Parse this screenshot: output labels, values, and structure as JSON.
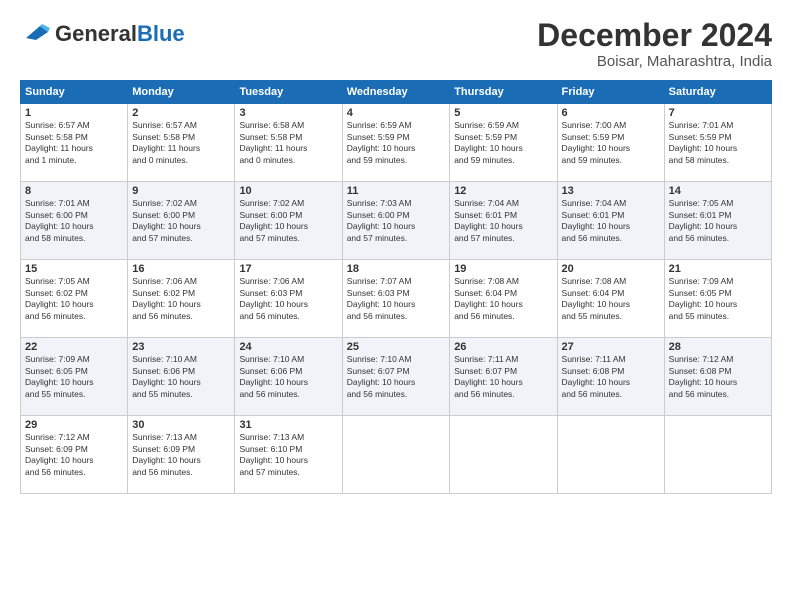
{
  "logo": {
    "general": "General",
    "blue": "Blue"
  },
  "title": "December 2024",
  "location": "Boisar, Maharashtra, India",
  "days_of_week": [
    "Sunday",
    "Monday",
    "Tuesday",
    "Wednesday",
    "Thursday",
    "Friday",
    "Saturday"
  ],
  "weeks": [
    [
      {
        "day": "1",
        "info": "Sunrise: 6:57 AM\nSunset: 5:58 PM\nDaylight: 11 hours\nand 1 minute."
      },
      {
        "day": "2",
        "info": "Sunrise: 6:57 AM\nSunset: 5:58 PM\nDaylight: 11 hours\nand 0 minutes."
      },
      {
        "day": "3",
        "info": "Sunrise: 6:58 AM\nSunset: 5:58 PM\nDaylight: 11 hours\nand 0 minutes."
      },
      {
        "day": "4",
        "info": "Sunrise: 6:59 AM\nSunset: 5:59 PM\nDaylight: 10 hours\nand 59 minutes."
      },
      {
        "day": "5",
        "info": "Sunrise: 6:59 AM\nSunset: 5:59 PM\nDaylight: 10 hours\nand 59 minutes."
      },
      {
        "day": "6",
        "info": "Sunrise: 7:00 AM\nSunset: 5:59 PM\nDaylight: 10 hours\nand 59 minutes."
      },
      {
        "day": "7",
        "info": "Sunrise: 7:01 AM\nSunset: 5:59 PM\nDaylight: 10 hours\nand 58 minutes."
      }
    ],
    [
      {
        "day": "8",
        "info": "Sunrise: 7:01 AM\nSunset: 6:00 PM\nDaylight: 10 hours\nand 58 minutes."
      },
      {
        "day": "9",
        "info": "Sunrise: 7:02 AM\nSunset: 6:00 PM\nDaylight: 10 hours\nand 57 minutes."
      },
      {
        "day": "10",
        "info": "Sunrise: 7:02 AM\nSunset: 6:00 PM\nDaylight: 10 hours\nand 57 minutes."
      },
      {
        "day": "11",
        "info": "Sunrise: 7:03 AM\nSunset: 6:00 PM\nDaylight: 10 hours\nand 57 minutes."
      },
      {
        "day": "12",
        "info": "Sunrise: 7:04 AM\nSunset: 6:01 PM\nDaylight: 10 hours\nand 57 minutes."
      },
      {
        "day": "13",
        "info": "Sunrise: 7:04 AM\nSunset: 6:01 PM\nDaylight: 10 hours\nand 56 minutes."
      },
      {
        "day": "14",
        "info": "Sunrise: 7:05 AM\nSunset: 6:01 PM\nDaylight: 10 hours\nand 56 minutes."
      }
    ],
    [
      {
        "day": "15",
        "info": "Sunrise: 7:05 AM\nSunset: 6:02 PM\nDaylight: 10 hours\nand 56 minutes."
      },
      {
        "day": "16",
        "info": "Sunrise: 7:06 AM\nSunset: 6:02 PM\nDaylight: 10 hours\nand 56 minutes."
      },
      {
        "day": "17",
        "info": "Sunrise: 7:06 AM\nSunset: 6:03 PM\nDaylight: 10 hours\nand 56 minutes."
      },
      {
        "day": "18",
        "info": "Sunrise: 7:07 AM\nSunset: 6:03 PM\nDaylight: 10 hours\nand 56 minutes."
      },
      {
        "day": "19",
        "info": "Sunrise: 7:08 AM\nSunset: 6:04 PM\nDaylight: 10 hours\nand 56 minutes."
      },
      {
        "day": "20",
        "info": "Sunrise: 7:08 AM\nSunset: 6:04 PM\nDaylight: 10 hours\nand 55 minutes."
      },
      {
        "day": "21",
        "info": "Sunrise: 7:09 AM\nSunset: 6:05 PM\nDaylight: 10 hours\nand 55 minutes."
      }
    ],
    [
      {
        "day": "22",
        "info": "Sunrise: 7:09 AM\nSunset: 6:05 PM\nDaylight: 10 hours\nand 55 minutes."
      },
      {
        "day": "23",
        "info": "Sunrise: 7:10 AM\nSunset: 6:06 PM\nDaylight: 10 hours\nand 55 minutes."
      },
      {
        "day": "24",
        "info": "Sunrise: 7:10 AM\nSunset: 6:06 PM\nDaylight: 10 hours\nand 56 minutes."
      },
      {
        "day": "25",
        "info": "Sunrise: 7:10 AM\nSunset: 6:07 PM\nDaylight: 10 hours\nand 56 minutes."
      },
      {
        "day": "26",
        "info": "Sunrise: 7:11 AM\nSunset: 6:07 PM\nDaylight: 10 hours\nand 56 minutes."
      },
      {
        "day": "27",
        "info": "Sunrise: 7:11 AM\nSunset: 6:08 PM\nDaylight: 10 hours\nand 56 minutes."
      },
      {
        "day": "28",
        "info": "Sunrise: 7:12 AM\nSunset: 6:08 PM\nDaylight: 10 hours\nand 56 minutes."
      }
    ],
    [
      {
        "day": "29",
        "info": "Sunrise: 7:12 AM\nSunset: 6:09 PM\nDaylight: 10 hours\nand 56 minutes."
      },
      {
        "day": "30",
        "info": "Sunrise: 7:13 AM\nSunset: 6:09 PM\nDaylight: 10 hours\nand 56 minutes."
      },
      {
        "day": "31",
        "info": "Sunrise: 7:13 AM\nSunset: 6:10 PM\nDaylight: 10 hours\nand 57 minutes."
      },
      {
        "day": "",
        "info": ""
      },
      {
        "day": "",
        "info": ""
      },
      {
        "day": "",
        "info": ""
      },
      {
        "day": "",
        "info": ""
      }
    ]
  ]
}
